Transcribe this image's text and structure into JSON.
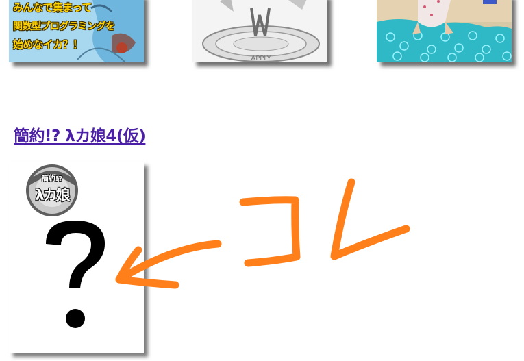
{
  "books": [
    {
      "cover_lines": [
        "みんなで集まって",
        "関数型プログラミングを",
        "始めなイカ？！"
      ],
      "icon": "squid-girl-cover-illustration"
    },
    {
      "icon": "apply-sculpture-cover-illustration"
    },
    {
      "icon": "squid-girl-beach-cover-illustration"
    }
  ],
  "heading": {
    "link_text": "簡約!? λカ娘4(仮)"
  },
  "placeholder_cover": {
    "logo_top": "簡約!?",
    "logo_main": "λカ娘",
    "icon": "question-mark-icon"
  },
  "annotation": {
    "icon": "handwritten-arrow-kore-annotation",
    "color": "#ff7f1a"
  },
  "colors": {
    "link": "#4b1fa6",
    "cover_text": "#ffd400",
    "annotation": "#ff7f1a"
  }
}
